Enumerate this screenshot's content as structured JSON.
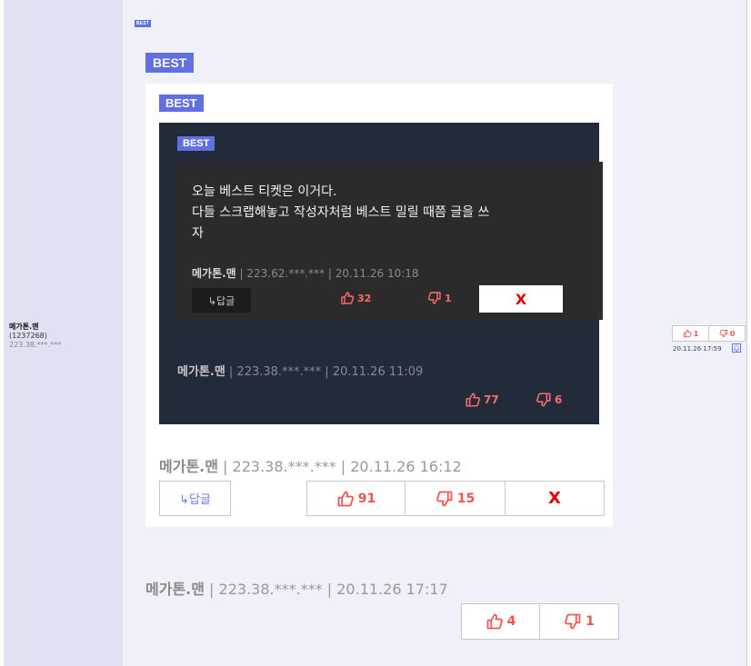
{
  "author_panel": {
    "nickname": "메가톤.맨",
    "user_id": "(1237268)",
    "ip": "223.38.***.***"
  },
  "best_label": "BEST",
  "nested_l3": {
    "text_lines": [
      "오늘 베스트 티켓은 이거다.",
      "다들 스크랩해놓고 작성자처럼 베스트 밀릴 때쯤 글을 쓰",
      "자"
    ],
    "author": "메가톤.맨",
    "meta": " | 223.62.***.*** | 20.11.26 10:18",
    "reply_label": "↳답글",
    "up_count": "32",
    "down_count": "1",
    "x_label": "X"
  },
  "nested_l2": {
    "author": "메가톤.맨",
    "meta": " | 223.38.***.*** | 20.11.26 11:09",
    "up_count": "77",
    "down_count": "6"
  },
  "nested_l1": {
    "author": "메가톤.맨",
    "meta": " | 223.38.***.*** | 20.11.26 16:12",
    "reply_label": "↳답글",
    "up_count": "91",
    "down_count": "15",
    "x_label": "X"
  },
  "post_l0": {
    "author": "메가톤.맨",
    "meta": " | 223.38.***.*** | 20.11.26 17:17",
    "up_count": "4",
    "down_count": "1"
  },
  "right_panel": {
    "up_count": "1",
    "down_count": "0",
    "timestamp": "20.11.26 17:59"
  },
  "colors": {
    "accent": "#6070e2",
    "vote": "#ff6b6b",
    "x_red": "#e20000"
  },
  "icons": {
    "thumbs_up": "thumbs-up-icon",
    "thumbs_down": "thumbs-down-icon",
    "bell": "bell-icon"
  }
}
